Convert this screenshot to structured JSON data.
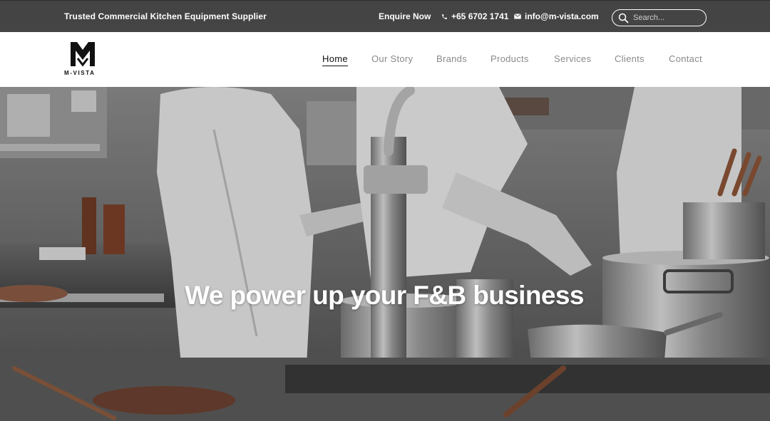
{
  "topbar": {
    "tagline": "Trusted Commercial Kitchen Equipment Supplier",
    "enquire_label": "Enquire Now",
    "phone": "+65 6702 1741",
    "phone_icon": "phone-icon",
    "email": "info@m-vista.com",
    "email_icon": "envelope-icon",
    "search_placeholder": "Search...",
    "search_icon": "search-icon"
  },
  "brand": {
    "logo_text": "M-VISTA"
  },
  "nav": {
    "items": [
      {
        "label": "Home",
        "active": true
      },
      {
        "label": "Our Story",
        "active": false
      },
      {
        "label": "Brands",
        "active": false
      },
      {
        "label": "Products",
        "active": false
      },
      {
        "label": "Services",
        "active": false
      },
      {
        "label": "Clients",
        "active": false
      },
      {
        "label": "Contact",
        "active": false
      }
    ]
  },
  "hero": {
    "title": "We power up your F&B business",
    "image": "chefs-cooking-in-commercial-kitchen"
  },
  "colors": {
    "topbar_bg": "#444444",
    "nav_active": "#111111",
    "nav_inactive": "#8a8a8a"
  }
}
